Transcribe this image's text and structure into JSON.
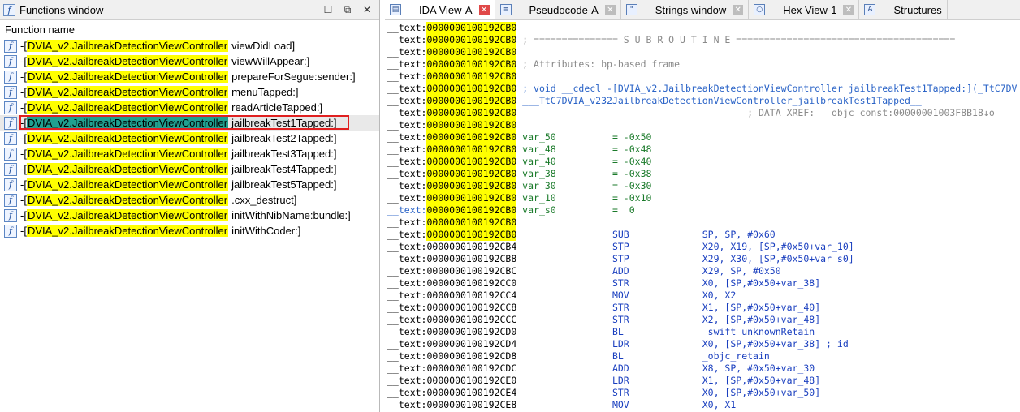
{
  "functions_window": {
    "title": "Functions window",
    "column_header": "Function name",
    "items": [
      {
        "prefix": "-[",
        "cls": "DVIA_v2.JailbreakDetectionViewController",
        "method": "viewDidLoad]",
        "selected": false
      },
      {
        "prefix": "-[",
        "cls": "DVIA_v2.JailbreakDetectionViewController",
        "method": "viewWillAppear:]",
        "selected": false
      },
      {
        "prefix": "-[",
        "cls": "DVIA_v2.JailbreakDetectionViewController",
        "method": "prepareForSegue:sender:]",
        "selected": false
      },
      {
        "prefix": "-[",
        "cls": "DVIA_v2.JailbreakDetectionViewController",
        "method": "menuTapped:]",
        "selected": false
      },
      {
        "prefix": "-[",
        "cls": "DVIA_v2.JailbreakDetectionViewController",
        "method": "readArticleTapped:]",
        "selected": false
      },
      {
        "prefix": "-[",
        "cls": "DVIA_v2.JailbreakDetectionViewController",
        "method": "jailbreakTest1Tapped:]",
        "selected": true
      },
      {
        "prefix": "-[",
        "cls": "DVIA_v2.JailbreakDetectionViewController",
        "method": "jailbreakTest2Tapped:]",
        "selected": false
      },
      {
        "prefix": "-[",
        "cls": "DVIA_v2.JailbreakDetectionViewController",
        "method": "jailbreakTest3Tapped:]",
        "selected": false
      },
      {
        "prefix": "-[",
        "cls": "DVIA_v2.JailbreakDetectionViewController",
        "method": "jailbreakTest4Tapped:]",
        "selected": false
      },
      {
        "prefix": "-[",
        "cls": "DVIA_v2.JailbreakDetectionViewController",
        "method": "jailbreakTest5Tapped:]",
        "selected": false
      },
      {
        "prefix": "-[",
        "cls": "DVIA_v2.JailbreakDetectionViewController",
        "method": ".cxx_destruct]",
        "selected": false
      },
      {
        "prefix": "-[",
        "cls": "DVIA_v2.JailbreakDetectionViewController",
        "method": "initWithNibName:bundle:]",
        "selected": false
      },
      {
        "prefix": "-[",
        "cls": "DVIA_v2.JailbreakDetectionViewController",
        "method": "initWithCoder:]",
        "selected": false
      }
    ]
  },
  "tabs": [
    {
      "label": "IDA View-A",
      "icon": "ida-view-icon",
      "active": true
    },
    {
      "label": "Pseudocode-A",
      "icon": "pseudocode-icon",
      "active": false
    },
    {
      "label": "Strings window",
      "icon": "strings-icon",
      "active": false
    },
    {
      "label": "Hex View-1",
      "icon": "hex-view-icon",
      "active": false
    },
    {
      "label": "Structures",
      "icon": "structures-icon",
      "active": false
    }
  ],
  "disasm_lines": [
    {
      "seg": "__text:",
      "addr": "0000000100192CB0",
      "hl": true,
      "after": ""
    },
    {
      "seg": "__text:",
      "addr": "0000000100192CB0",
      "hl": true,
      "after": " ; =============== S U B R O U T I N E =======================================",
      "kind": "cmt"
    },
    {
      "seg": "__text:",
      "addr": "0000000100192CB0",
      "hl": true,
      "after": ""
    },
    {
      "seg": "__text:",
      "addr": "0000000100192CB0",
      "hl": true,
      "after": " ; Attributes: bp-based frame",
      "kind": "cmt"
    },
    {
      "seg": "__text:",
      "addr": "0000000100192CB0",
      "hl": true,
      "after": ""
    },
    {
      "seg": "__text:",
      "addr": "0000000100192CB0",
      "hl": true,
      "after": " ; void __cdecl -[DVIA_v2.JailbreakDetectionViewController jailbreakTest1Tapped:](_TtC7DV",
      "kind": "decl"
    },
    {
      "seg": "__text:",
      "addr": "0000000100192CB0",
      "hl": true,
      "after": " ___TtC7DVIA_v232JailbreakDetectionViewController_jailbreakTest1Tapped__",
      "kind": "decl"
    },
    {
      "seg": "__text:",
      "addr": "0000000100192CB0",
      "hl": true,
      "after": "                                         ; DATA XREF: __objc_const:00000001003F8B18↓o",
      "kind": "cmt"
    },
    {
      "seg": "__text:",
      "addr": "0000000100192CB0",
      "hl": true,
      "after": ""
    },
    {
      "seg": "__text:",
      "addr": "0000000100192CB0",
      "hl": true,
      "after": " var_50          = -0x50",
      "kind": "var"
    },
    {
      "seg": "__text:",
      "addr": "0000000100192CB0",
      "hl": true,
      "after": " var_48          = -0x48",
      "kind": "var"
    },
    {
      "seg": "__text:",
      "addr": "0000000100192CB0",
      "hl": true,
      "after": " var_40          = -0x40",
      "kind": "var"
    },
    {
      "seg": "__text:",
      "addr": "0000000100192CB0",
      "hl": true,
      "after": " var_38          = -0x38",
      "kind": "var"
    },
    {
      "seg": "__text:",
      "addr": "0000000100192CB0",
      "hl": true,
      "after": " var_30          = -0x30",
      "kind": "var"
    },
    {
      "seg": "__text:",
      "addr": "0000000100192CB0",
      "hl": true,
      "after": " var_10          = -0x10",
      "kind": "var"
    },
    {
      "seg": "__text:",
      "addr": "0000000100192CB0",
      "hl": true,
      "after": " var_s0          =  0",
      "kind": "var",
      "segblue": true
    },
    {
      "seg": "__text:",
      "addr": "0000000100192CB0",
      "hl": true,
      "after": ""
    },
    {
      "seg": "__text:",
      "addr": "0000000100192CB0",
      "hl": true,
      "after": "                 SUB             SP, SP, #0x60",
      "kind": "ins"
    },
    {
      "seg": "__text:",
      "addr": "0000000100192CB4",
      "hl": false,
      "after": "                 STP             X20, X19, [SP,#0x50+var_10]",
      "kind": "ins"
    },
    {
      "seg": "__text:",
      "addr": "0000000100192CB8",
      "hl": false,
      "after": "                 STP             X29, X30, [SP,#0x50+var_s0]",
      "kind": "ins"
    },
    {
      "seg": "__text:",
      "addr": "0000000100192CBC",
      "hl": false,
      "after": "                 ADD             X29, SP, #0x50",
      "kind": "ins"
    },
    {
      "seg": "__text:",
      "addr": "0000000100192CC0",
      "hl": false,
      "after": "                 STR             X0, [SP,#0x50+var_38]",
      "kind": "ins"
    },
    {
      "seg": "__text:",
      "addr": "0000000100192CC4",
      "hl": false,
      "after": "                 MOV             X0, X2",
      "kind": "ins"
    },
    {
      "seg": "__text:",
      "addr": "0000000100192CC8",
      "hl": false,
      "after": "                 STR             X1, [SP,#0x50+var_40]",
      "kind": "ins"
    },
    {
      "seg": "__text:",
      "addr": "0000000100192CCC",
      "hl": false,
      "after": "                 STR             X2, [SP,#0x50+var_48]",
      "kind": "ins"
    },
    {
      "seg": "__text:",
      "addr": "0000000100192CD0",
      "hl": false,
      "after": "                 BL              _swift_unknownRetain",
      "kind": "ins"
    },
    {
      "seg": "__text:",
      "addr": "0000000100192CD4",
      "hl": false,
      "after": "                 LDR             X0, [SP,#0x50+var_38] ; id",
      "kind": "ins"
    },
    {
      "seg": "__text:",
      "addr": "0000000100192CD8",
      "hl": false,
      "after": "                 BL              _objc_retain",
      "kind": "ins"
    },
    {
      "seg": "__text:",
      "addr": "0000000100192CDC",
      "hl": false,
      "after": "                 ADD             X8, SP, #0x50+var_30",
      "kind": "ins"
    },
    {
      "seg": "__text:",
      "addr": "0000000100192CE0",
      "hl": false,
      "after": "                 LDR             X1, [SP,#0x50+var_48]",
      "kind": "ins"
    },
    {
      "seg": "__text:",
      "addr": "0000000100192CE4",
      "hl": false,
      "after": "                 STR             X0, [SP,#0x50+var_50]",
      "kind": "ins"
    },
    {
      "seg": "__text:",
      "addr": "0000000100192CE8",
      "hl": false,
      "after": "                 MOV             X0, X1",
      "kind": "ins"
    }
  ],
  "colors": {
    "class_highlight": "#ffff00",
    "selected_class_highlight": "#20a090",
    "selection_border": "#e02020",
    "address_highlight": "#ffff00",
    "comment": "#8a8a8a",
    "declaration": "#2a63c7",
    "variable": "#1a7a2a",
    "mnemonic": "#1a3fbf"
  }
}
